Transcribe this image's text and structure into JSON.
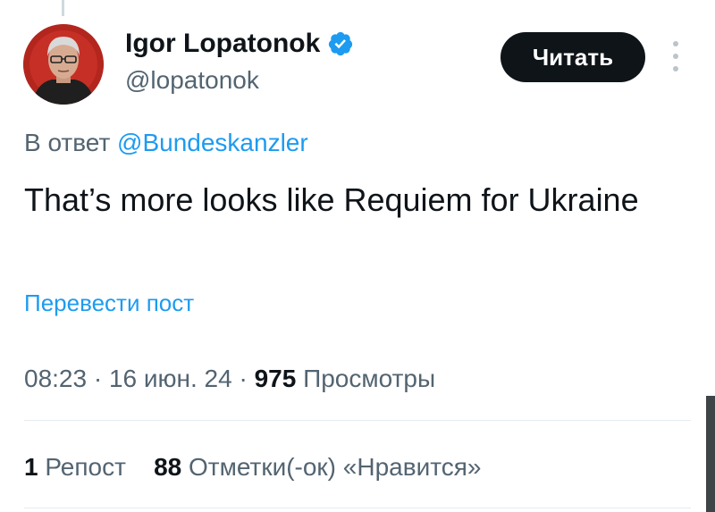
{
  "author": {
    "name": "Igor Lopatonok",
    "handle": "@lopatonok",
    "verified_icon": "verified-badge-icon",
    "avatar_icon": "profile-avatar"
  },
  "follow_button": {
    "label": "Читать"
  },
  "more_menu": {
    "icon": "more-vertical-icon"
  },
  "reply": {
    "prefix": "В ответ",
    "mention": "@Bundeskanzler"
  },
  "tweet": {
    "text": "That’s more looks like Requiem for Ukraine"
  },
  "translate": {
    "label": "Перевести пост"
  },
  "meta": {
    "time": "08:23",
    "separator": "·",
    "date": "16 июн. 24",
    "views_count": "975",
    "views_label": "Просмотры"
  },
  "stats": {
    "reposts_count": "1",
    "reposts_label": "Репост",
    "likes_count": "88",
    "likes_label": "Отметки(-ок) «Нравится»"
  },
  "colors": {
    "accent": "#1d9bf0",
    "text": "#0f1419",
    "secondary": "#536471",
    "button_bg": "#0f1419"
  }
}
